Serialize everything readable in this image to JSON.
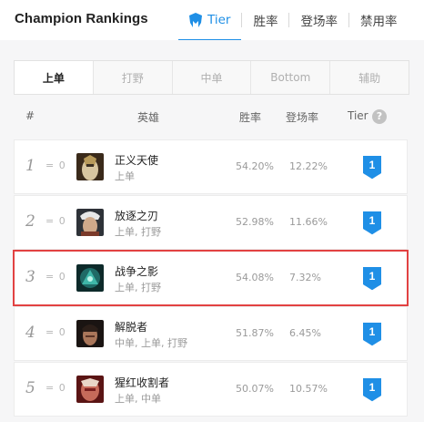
{
  "header": {
    "title": "Champion Rankings",
    "tabs": [
      {
        "label": "Tier",
        "active": true
      },
      {
        "label": "胜率",
        "active": false
      },
      {
        "label": "登场率",
        "active": false
      },
      {
        "label": "禁用率",
        "active": false
      }
    ]
  },
  "lanes": [
    {
      "label": "上单",
      "active": true
    },
    {
      "label": "打野",
      "active": false
    },
    {
      "label": "中单",
      "active": false
    },
    {
      "label": "Bottom",
      "active": false
    },
    {
      "label": "辅助",
      "active": false
    }
  ],
  "table": {
    "columns": {
      "rank": "#",
      "champion": "英雄",
      "win_rate": "胜率",
      "pick_rate": "登场率",
      "tier": "Tier",
      "help": "?"
    },
    "rows": [
      {
        "rank": "1",
        "change": "= 0",
        "name": "正义天使",
        "roles": "上单",
        "win_rate": "54.20%",
        "pick_rate": "12.22%",
        "tier": "1",
        "highlight": false
      },
      {
        "rank": "2",
        "change": "= 0",
        "name": "放逐之刃",
        "roles": "上单, 打野",
        "win_rate": "52.98%",
        "pick_rate": "11.66%",
        "tier": "1",
        "highlight": false
      },
      {
        "rank": "3",
        "change": "= 0",
        "name": "战争之影",
        "roles": "上单, 打野",
        "win_rate": "54.08%",
        "pick_rate": "7.32%",
        "tier": "1",
        "highlight": true
      },
      {
        "rank": "4",
        "change": "= 0",
        "name": "解脱者",
        "roles": "中单, 上单, 打野",
        "win_rate": "51.87%",
        "pick_rate": "6.45%",
        "tier": "1",
        "highlight": false
      },
      {
        "rank": "5",
        "change": "= 0",
        "name": "猩红收割者",
        "roles": "上单, 中单",
        "win_rate": "50.07%",
        "pick_rate": "10.57%",
        "tier": "1",
        "highlight": false
      }
    ]
  },
  "colors": {
    "accent": "#1f8fe6",
    "highlight": "#e24242"
  }
}
